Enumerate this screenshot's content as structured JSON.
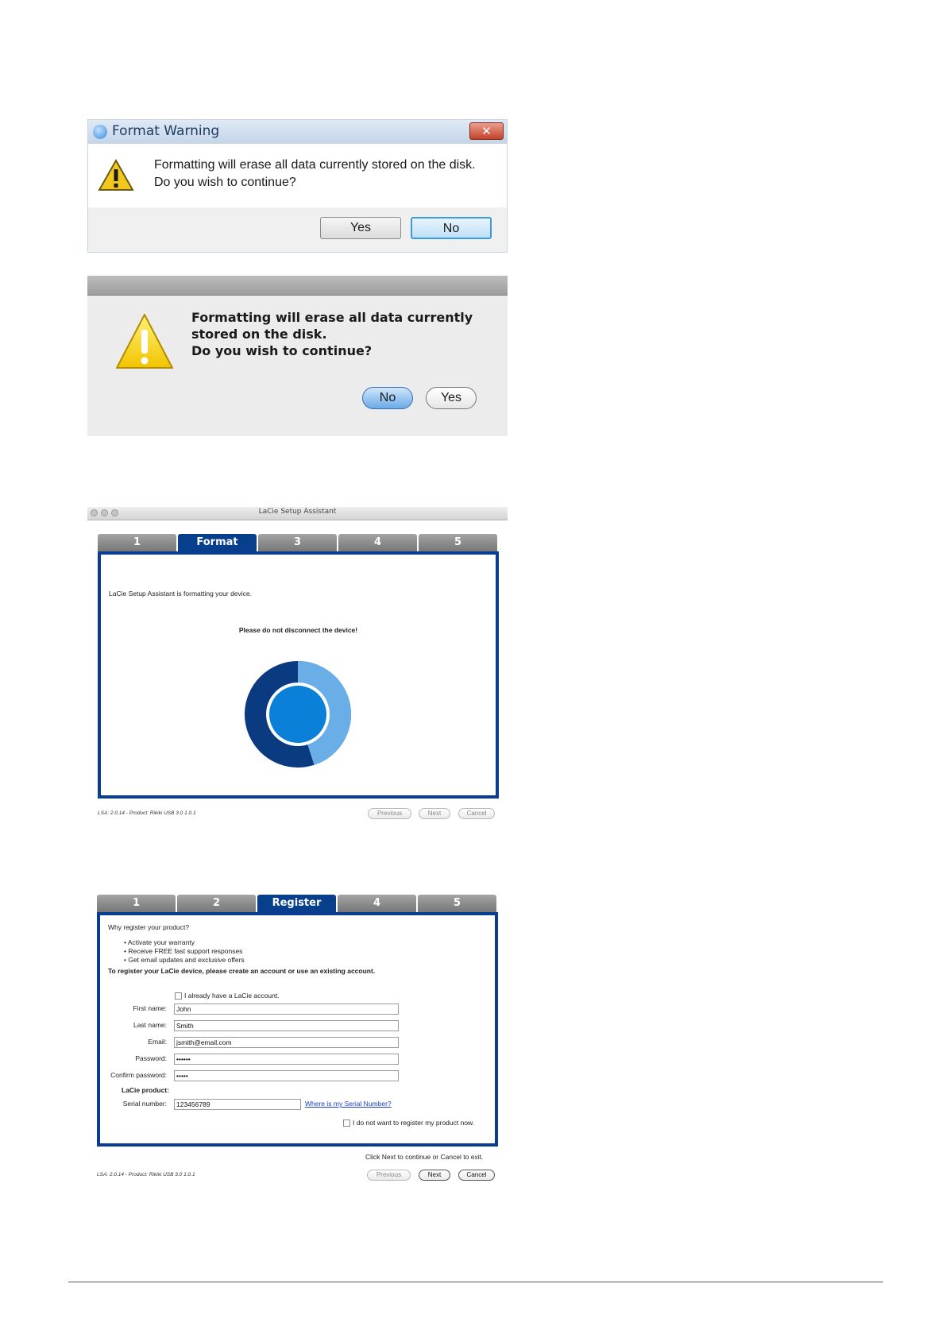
{
  "windows_dialog": {
    "title": "Format Warning",
    "close_glyph": "✕",
    "message_line1": "Formatting will erase all data currently stored on the disk.",
    "message_line2": "Do you wish to continue?",
    "yes_label": "Yes",
    "no_label": "No"
  },
  "mac_dialog": {
    "message_line1": "Formatting will erase all data currently",
    "message_line2": "stored on the disk.",
    "message_line3": "Do you wish to continue?",
    "no_label": "No",
    "yes_label": "Yes"
  },
  "format_window": {
    "title": "LaCie Setup Assistant",
    "tabs": [
      "1",
      "Format",
      "3",
      "4",
      "5"
    ],
    "status_text": "LaCie Setup Assistant is formatting your device.",
    "warning_text": "Please do not disconnect the device!",
    "progress": 0.45,
    "colors": {
      "dark": "#0a3a80",
      "light": "#6aaee8",
      "center": "#0a80d8"
    },
    "version": "LSA: 2.0.14 - Product: Rikiki USB 3.0 1.0.1",
    "previous_label": "Previous",
    "next_label": "Next",
    "cancel_label": "Cancel"
  },
  "register_window": {
    "tabs": [
      "1",
      "2",
      "Register",
      "4",
      "5"
    ],
    "why": "Why register your product?",
    "bullets": [
      "Activate your warranty",
      "Receive FREE fast support responses",
      "Get email updates and exclusive offers"
    ],
    "instruction": "To register your LaCie device, please create an account or use an existing account.",
    "already_have": "I already have a LaCie account.",
    "first_name_label": "First name:",
    "first_name_value": "John",
    "last_name_label": "Last name:",
    "last_name_value": "Smith",
    "email_label": "Email:",
    "email_value": "jsmith@email.com",
    "password_label": "Password:",
    "password_value": "••••••",
    "confirm_label": "Confirm password:",
    "confirm_value": "•••••",
    "product_heading": "LaCie product:",
    "serial_label": "Serial number:",
    "serial_value": "123456789",
    "serial_link": "Where is my Serial Number?",
    "no_register": "I do not want to register my product now.",
    "click_next": "Click Next to continue or Cancel to exit.",
    "version": "LSA: 2.0.14 - Product: Rikiki USB 3.0 1.0.1",
    "previous_label": "Previous",
    "next_label": "Next",
    "cancel_label": "Cancel"
  }
}
